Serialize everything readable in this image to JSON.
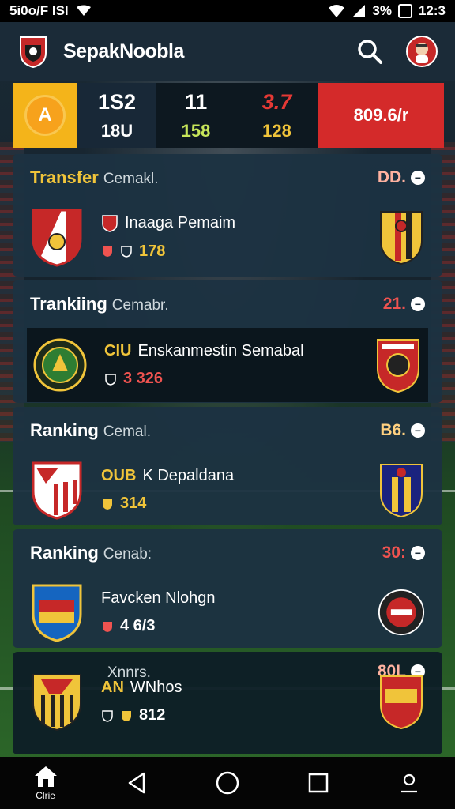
{
  "status_bar": {
    "left_text": "5i0o/F ISI",
    "battery_text": "3%",
    "time": "12:3"
  },
  "app": {
    "title": "SepakNoobla"
  },
  "scoreboard": {
    "badge_letter": "A",
    "col1": {
      "top": "1S2",
      "bottom": "18U"
    },
    "col2": {
      "top": "11",
      "bottom": "158"
    },
    "col3": {
      "top": "3.7",
      "bottom": "128"
    },
    "total": "809.6/r"
  },
  "cards": [
    {
      "title": "Transfer",
      "subtitle": "Cemakl.",
      "value": "DD.",
      "info_tag": "",
      "info_text": "Inaaga Pemaim",
      "stat": "178",
      "value_color": "#ffb2a0"
    },
    {
      "title": "Trankiing",
      "subtitle": "Cemabr.",
      "value": "21.",
      "info_tag": "CIU",
      "info_text": "Enskanmestin Semabal",
      "stat": "3 326",
      "value_color": "#ef5350"
    },
    {
      "title": "Ranking",
      "subtitle": "Cemal.",
      "value": "B6.",
      "info_tag": "OUB",
      "info_text": "K Depaldana",
      "stat": "314",
      "value_color": "#ffd180"
    },
    {
      "title": "Ranking",
      "subtitle": "Cenab:",
      "value": "30:",
      "info_tag": "",
      "info_text": "Favcken Nlohgn",
      "stat": "4 6/3",
      "value_color": "#ef5350"
    },
    {
      "title": "",
      "subtitle": "Xnnrs.",
      "value": "80L",
      "info_tag": "AN",
      "info_text": "WNhos",
      "stat": "812",
      "value_color": "#ffb2a0"
    }
  ],
  "bottom_nav": {
    "home_label": "Clrie"
  },
  "colors": {
    "accent_yellow": "#f0c43a",
    "accent_red": "#d42a2a",
    "card_bg": "#1c3242"
  }
}
